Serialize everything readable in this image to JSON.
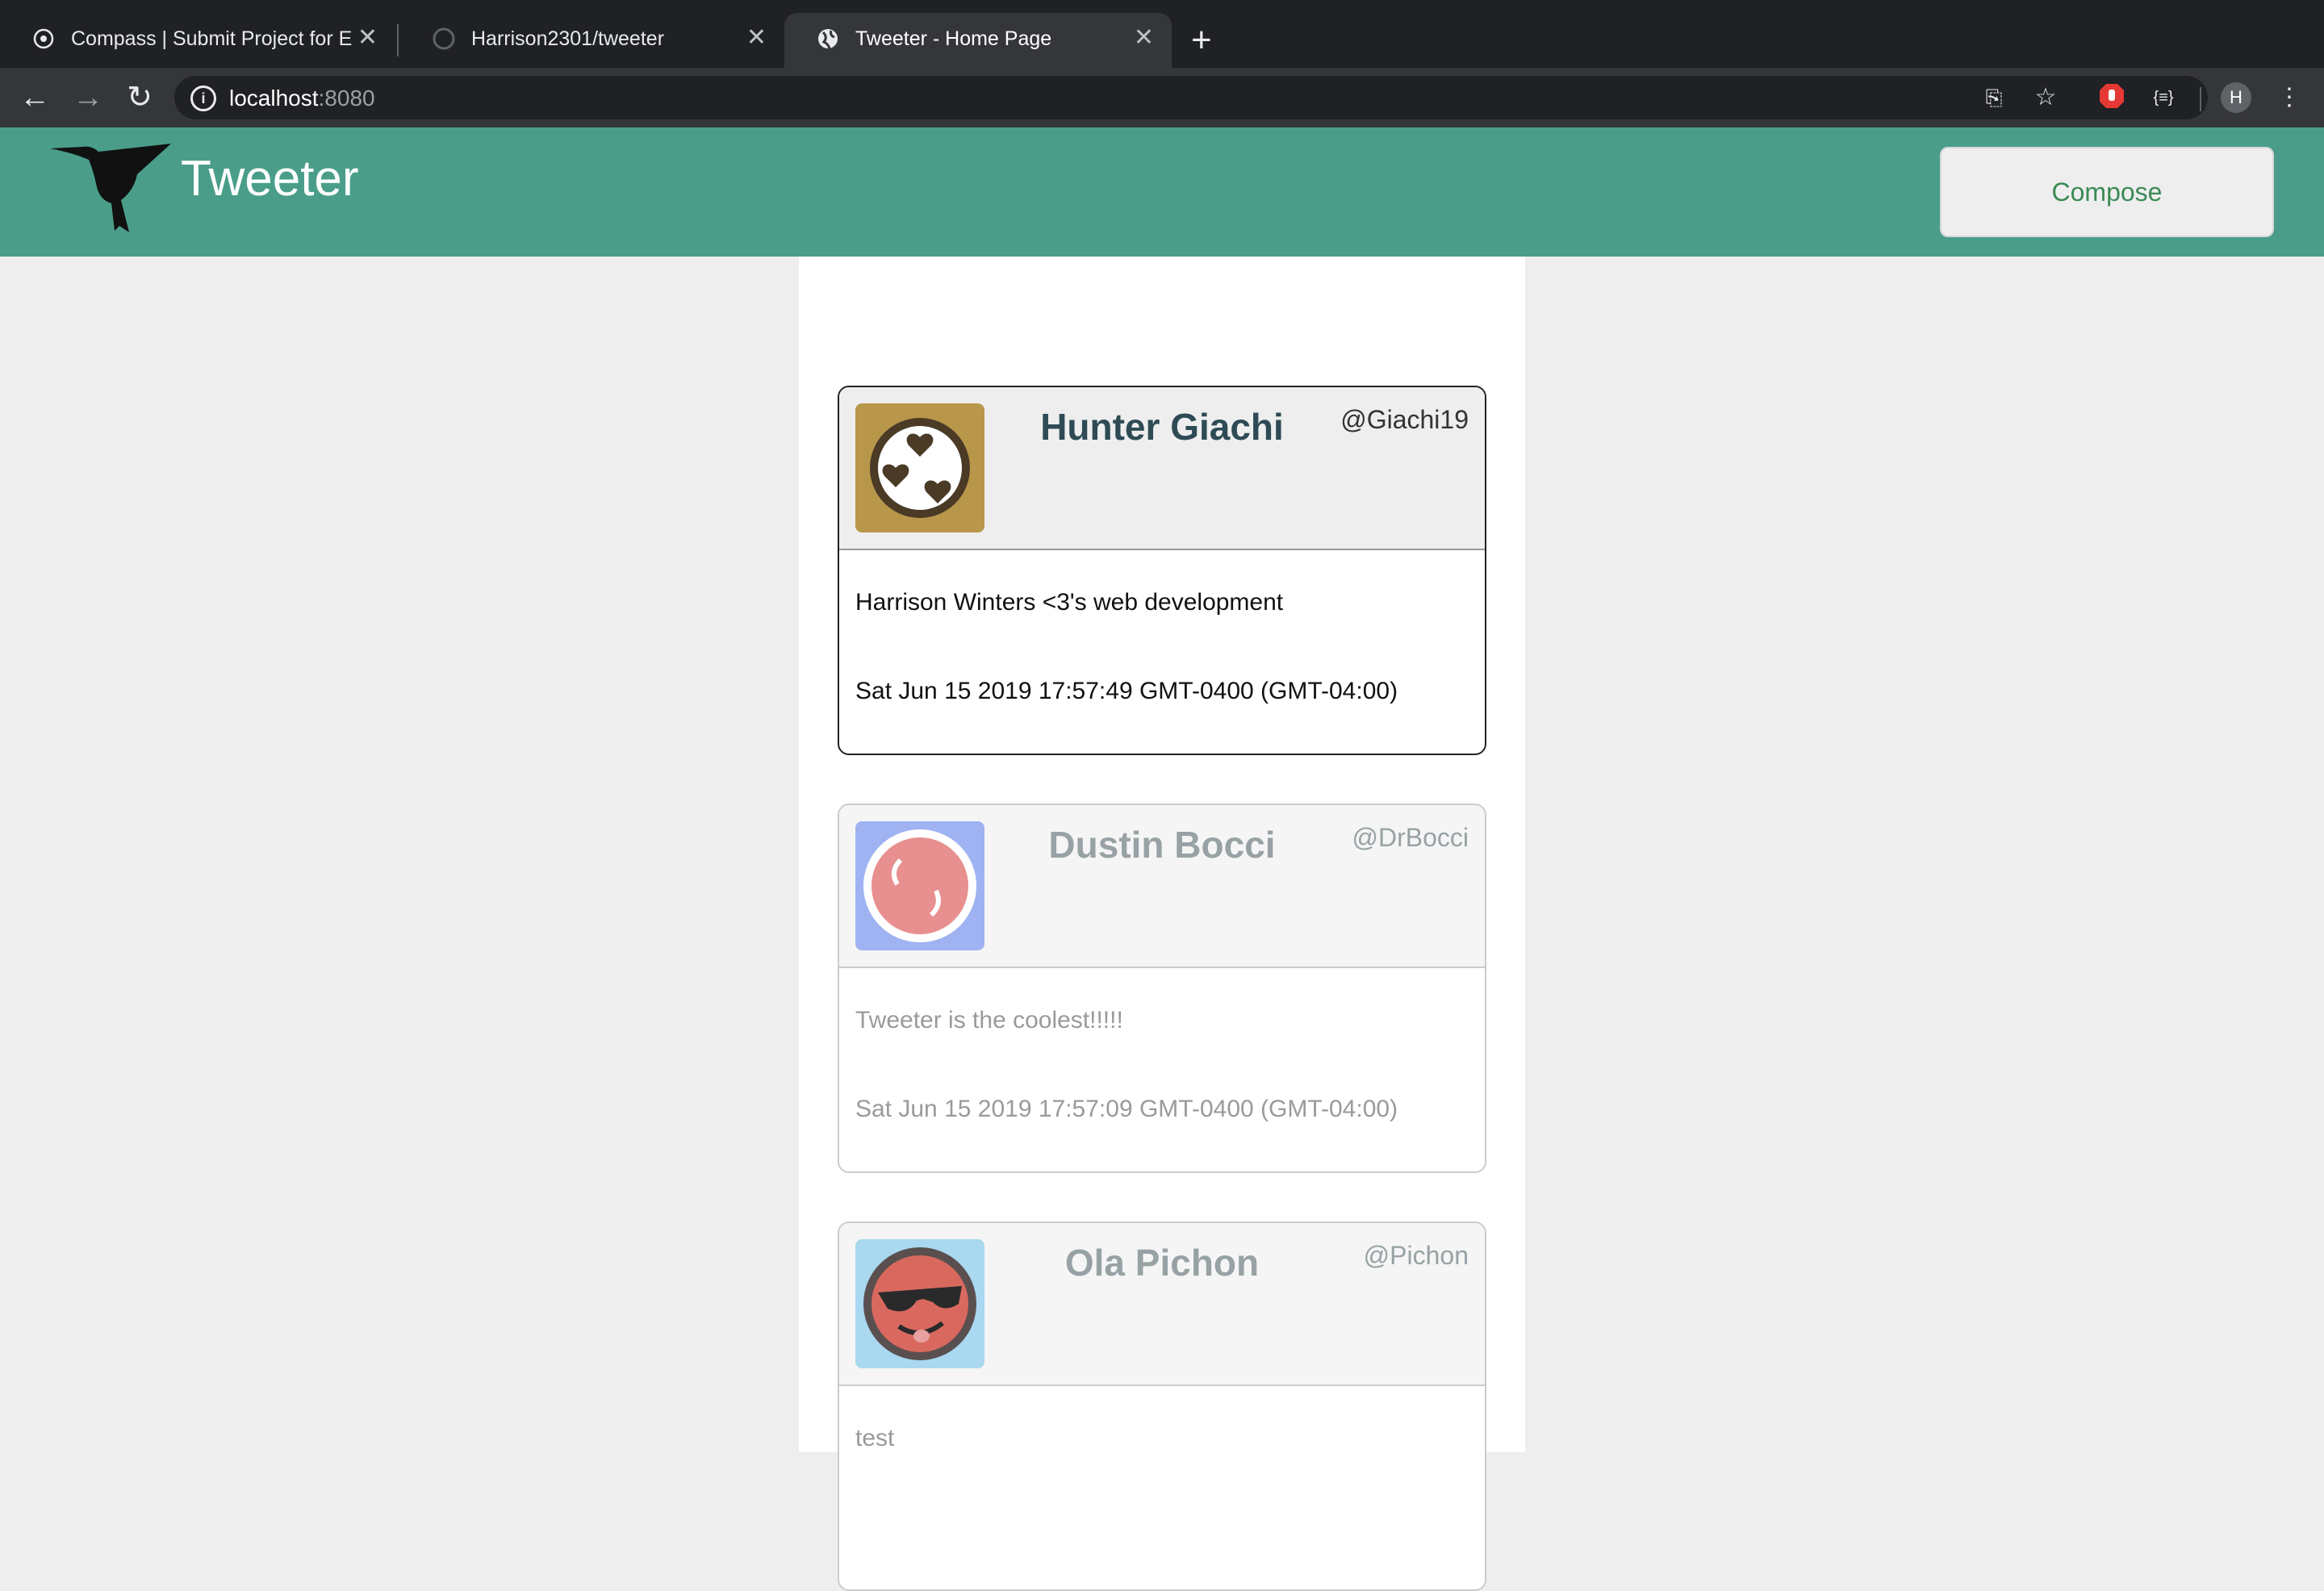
{
  "browser": {
    "tabs": [
      {
        "title": "Compass | Submit Project for E",
        "favicon": "compass-icon"
      },
      {
        "title": "Harrison2301/tweeter",
        "favicon": "github-icon"
      },
      {
        "title": "Tweeter - Home Page",
        "favicon": "globe-icon"
      }
    ],
    "new_tab": "+",
    "url_host": "localhost",
    "url_port": ":8080",
    "profile_initial": "H"
  },
  "header": {
    "brand": "Tweeter",
    "compose_label": "Compose",
    "logo": "hummingbird-logo"
  },
  "tweets": [
    {
      "name": "Hunter Giachi",
      "handle": "@Giachi19",
      "content": "Harrison Winters <3's web development",
      "date": "Sat Jun 15 2019 17:57:49 GMT-0400 (GMT-04:00)",
      "avatar_bg": "#b8964a"
    },
    {
      "name": "Dustin Bocci",
      "handle": "@DrBocci",
      "content": "Tweeter is the coolest!!!!!",
      "date": "Sat Jun 15 2019 17:57:09 GMT-0400 (GMT-04:00)",
      "avatar_bg": "#9fb3f3"
    },
    {
      "name": "Ola Pichon",
      "handle": "@Pichon",
      "content": "test",
      "date": "",
      "avatar_bg": "#a9d8f0"
    }
  ]
}
